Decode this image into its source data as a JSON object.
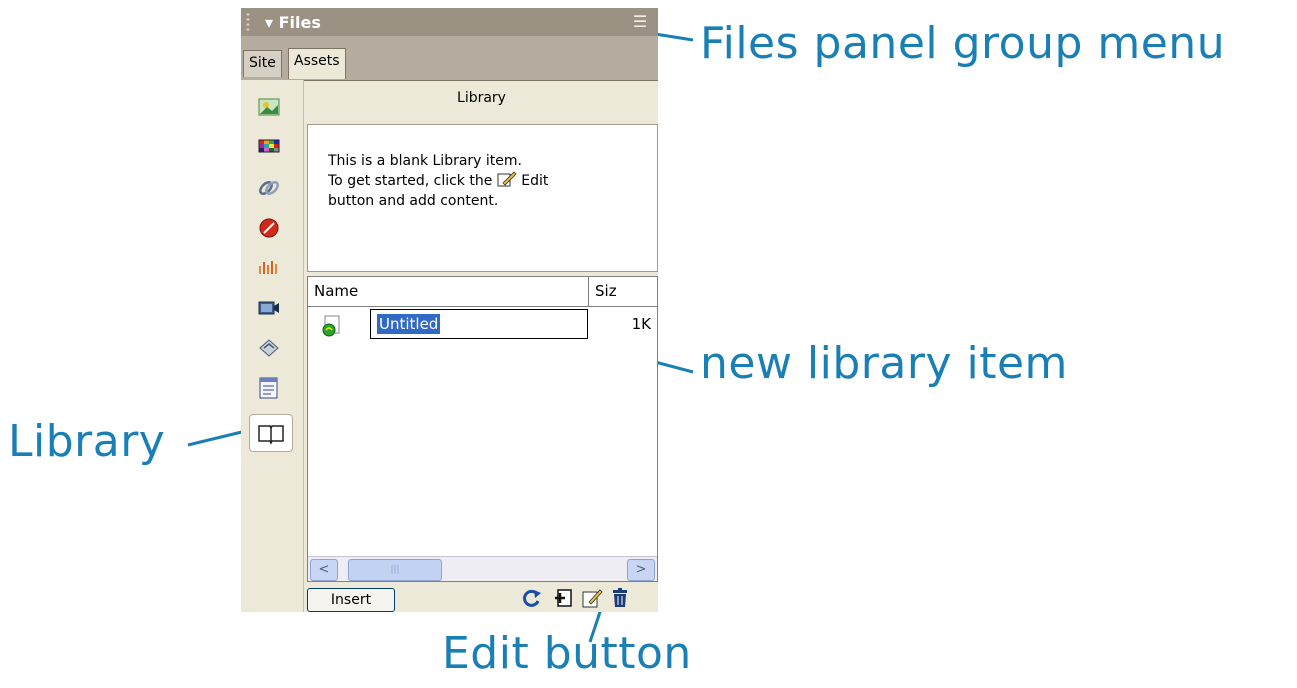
{
  "panel": {
    "title": "Files",
    "collapse_glyph": "▾",
    "menu_icon": "options-menu-icon",
    "tabs": [
      {
        "label": "Site",
        "active": false
      },
      {
        "label": "Assets",
        "active": true
      }
    ]
  },
  "sidebar": {
    "categories": [
      {
        "name": "images",
        "icon": "images-icon"
      },
      {
        "name": "colors",
        "icon": "colors-icon"
      },
      {
        "name": "urls",
        "icon": "urls-icon"
      },
      {
        "name": "flash",
        "icon": "flash-icon"
      },
      {
        "name": "shockwave",
        "icon": "shockwave-icon"
      },
      {
        "name": "movies",
        "icon": "movies-icon"
      },
      {
        "name": "scripts",
        "icon": "scripts-icon"
      },
      {
        "name": "templates",
        "icon": "templates-icon"
      },
      {
        "name": "library",
        "icon": "library-icon",
        "selected": true
      }
    ]
  },
  "library": {
    "heading": "Library",
    "preview": {
      "line1": "This is a blank Library item.",
      "line2_before": "To get started, click the",
      "line2_after": "Edit",
      "line3": "button and add content."
    },
    "columns": {
      "name": "Name",
      "size": "Siz"
    },
    "items": [
      {
        "name": "Untitled",
        "size": "1K",
        "editing": true
      }
    ],
    "insert_label": "Insert",
    "scrollbar": {
      "left": "<",
      "right": ">",
      "thumb_grip": "|||"
    }
  },
  "bottom_icons": [
    "refresh-icon",
    "new-item-icon",
    "edit-icon",
    "delete-icon"
  ],
  "callouts": {
    "menu": "Files panel group menu",
    "new_item": "new library item",
    "library": "Library",
    "edit": "Edit button"
  },
  "colors": {
    "callout": "#1a7fb5",
    "selection": "#316ac5",
    "titlebar": "#9c9284"
  }
}
